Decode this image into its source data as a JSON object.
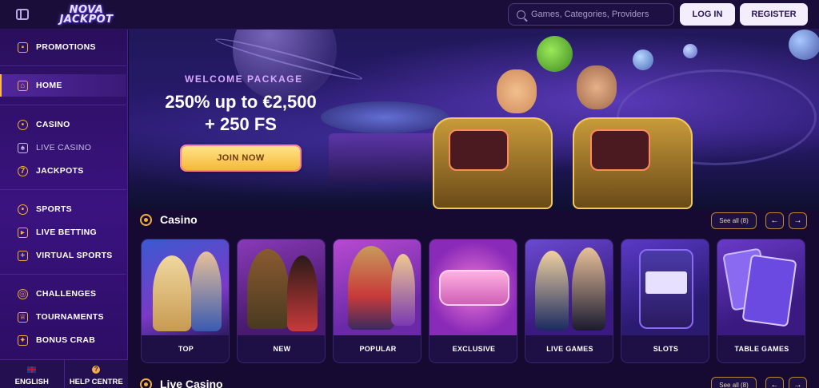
{
  "header": {
    "logo_line1": "NOVA",
    "logo_line2": "JACKPOT",
    "search_placeholder": "Games, Categories, Providers",
    "login_label": "LOG IN",
    "register_label": "REGISTER"
  },
  "sidebar": {
    "items": [
      {
        "label": "PROMOTIONS",
        "icon": "gift-icon"
      },
      {
        "label": "HOME",
        "icon": "home-icon",
        "active": true
      },
      {
        "label": "CASINO",
        "icon": "chip-icon"
      },
      {
        "label": "LIVE CASINO",
        "icon": "spade-icon"
      },
      {
        "label": "JACKPOTS",
        "icon": "seven-icon"
      },
      {
        "label": "SPORTS",
        "icon": "ball-icon"
      },
      {
        "label": "LIVE BETTING",
        "icon": "live-icon"
      },
      {
        "label": "VIRTUAL SPORTS",
        "icon": "gamepad-icon"
      },
      {
        "label": "CHALLENGES",
        "icon": "target-icon"
      },
      {
        "label": "TOURNAMENTS",
        "icon": "trophy-icon"
      },
      {
        "label": "BONUS CRAB",
        "icon": "crab-icon"
      }
    ],
    "footer": {
      "language": "ENGLISH",
      "help": "HELP CENTRE"
    }
  },
  "banner": {
    "eyebrow": "WELCOME PACKAGE",
    "headline_line1": "250% up to €2,500",
    "headline_line2": "+ 250 FS",
    "cta": "JOIN NOW"
  },
  "casino": {
    "title": "Casino",
    "see_all": "See all (8)",
    "prev": "←",
    "next": "→",
    "cards": [
      "TOP",
      "NEW",
      "POPULAR",
      "EXCLUSIVE",
      "LIVE GAMES",
      "SLOTS",
      "TABLE GAMES"
    ]
  },
  "live_casino": {
    "title": "Live Casino",
    "see_all": "See all (8)"
  },
  "colors": {
    "accent": "#f0b040",
    "background": "#14092e",
    "sidebar": "#2a0f5c",
    "button_bg": "#f4eefc"
  }
}
